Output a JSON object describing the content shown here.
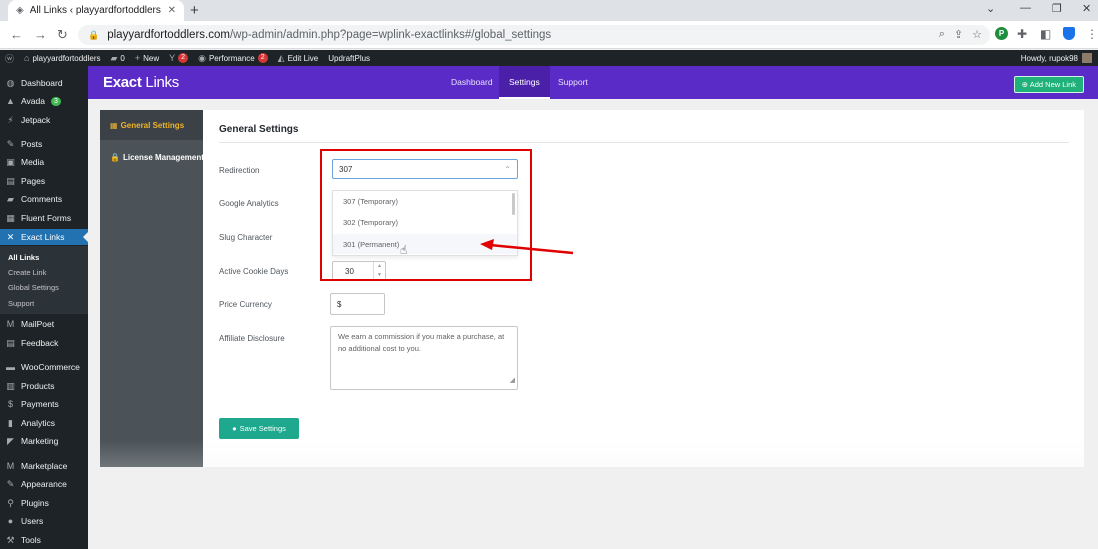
{
  "browser": {
    "tab_title": "All Links ‹ playyardfortoddlers —",
    "url_host": "playyardfortoddlers.com",
    "url_path": "/wp-admin/admin.php?page=wplink-exactlinks#/global_settings",
    "new_tab_glyph": "+",
    "ext_badge": "P"
  },
  "admin_bar": {
    "site_name": "playyardfortoddlers",
    "comments_count": "0",
    "new_label": "New",
    "yoast_count": "2",
    "performance_label": "Performance",
    "performance_count": "2",
    "edit_live_label": "Edit Live",
    "updraft_label": "UpdraftPlus",
    "howdy": "Howdy, rupok98"
  },
  "sidebar": {
    "items": [
      {
        "label": "Dashboard",
        "icon": "dashboard-icon"
      },
      {
        "label": "Avada",
        "icon": "avada-icon",
        "count": "3"
      },
      {
        "label": "Jetpack",
        "icon": "jetpack-icon"
      },
      {
        "label": "Posts",
        "icon": "pin-icon"
      },
      {
        "label": "Media",
        "icon": "media-icon"
      },
      {
        "label": "Pages",
        "icon": "pages-icon"
      },
      {
        "label": "Comments",
        "icon": "comments-icon"
      },
      {
        "label": "Fluent Forms",
        "icon": "forms-icon"
      },
      {
        "label": "Exact Links",
        "icon": "links-icon"
      },
      {
        "label": "MailPoet",
        "icon": "mailpoet-icon"
      },
      {
        "label": "Feedback",
        "icon": "feedback-icon"
      },
      {
        "label": "WooCommerce",
        "icon": "woo-icon"
      },
      {
        "label": "Products",
        "icon": "products-icon"
      },
      {
        "label": "Payments",
        "icon": "payments-icon"
      },
      {
        "label": "Analytics",
        "icon": "analytics-icon"
      },
      {
        "label": "Marketing",
        "icon": "marketing-icon"
      },
      {
        "label": "Marketplace",
        "icon": "marketplace-icon"
      },
      {
        "label": "Appearance",
        "icon": "appearance-icon"
      },
      {
        "label": "Plugins",
        "icon": "plugins-icon"
      },
      {
        "label": "Users",
        "icon": "users-icon"
      },
      {
        "label": "Tools",
        "icon": "tools-icon"
      }
    ],
    "submenu": [
      "All Links",
      "Create Link",
      "Global Settings",
      "Support"
    ]
  },
  "plugin_header": {
    "logo_bold": "Exact",
    "logo_thin": " Links",
    "tabs": [
      "Dashboard",
      "Settings",
      "Support"
    ],
    "add_new_label": "Add New Link"
  },
  "panel": {
    "side_items": [
      "General Settings",
      "License Management"
    ],
    "title": "General Settings",
    "fields": {
      "redirection_label": "Redirection",
      "redirection_value": "307",
      "google_analytics_label": "Google Analytics",
      "slug_char_label": "Slug Character",
      "cookie_days_label": "Active Cookie Days",
      "cookie_days_value": "30",
      "currency_label": "Price Currency",
      "currency_value": "$",
      "disclosure_label": "Affiliate Disclosure",
      "disclosure_value": "We earn a commission if you make a purchase, at no additional cost to you."
    },
    "redirection_options": [
      "307 (Temporary)",
      "302 (Temporary)",
      "301 (Permanent)"
    ],
    "save_label": "Save Settings"
  },
  "colors": {
    "plugin_purple": "#5b2bc7",
    "accent_green": "#1ea98e",
    "wp_dark": "#1d2327",
    "wp_blue": "#2271b1",
    "annotation_red": "#e00000"
  }
}
